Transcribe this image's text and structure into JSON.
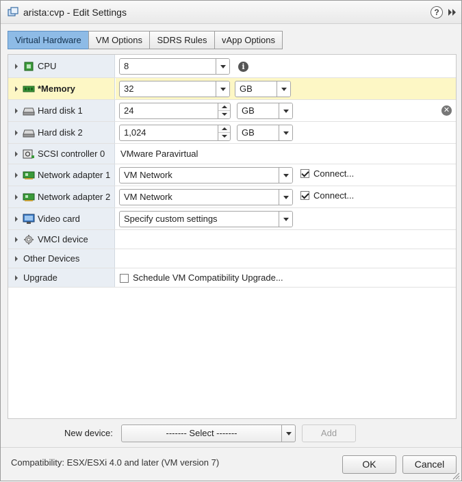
{
  "window": {
    "title": "arista:cvp - Edit Settings",
    "help_symbol": "?"
  },
  "tabs": [
    {
      "label": "Virtual Hardware",
      "active": true
    },
    {
      "label": "VM Options",
      "active": false
    },
    {
      "label": "SDRS Rules",
      "active": false
    },
    {
      "label": "vApp Options",
      "active": false
    }
  ],
  "hardware": {
    "cpu": {
      "label": "CPU",
      "value": "8",
      "icon": "cpu-chip-icon"
    },
    "memory": {
      "label": "*Memory",
      "value": "32",
      "unit": "GB",
      "icon": "memory-module-icon"
    },
    "hard_disk_1": {
      "label": "Hard disk 1",
      "value": "24",
      "unit": "GB",
      "icon": "hard-disk-icon"
    },
    "hard_disk_2": {
      "label": "Hard disk 2",
      "value": "1,024",
      "unit": "GB",
      "icon": "hard-disk-icon"
    },
    "scsi": {
      "label": "SCSI controller 0",
      "value": "VMware Paravirtual",
      "icon": "scsi-controller-icon"
    },
    "net1": {
      "label": "Network adapter 1",
      "value": "VM Network",
      "connect_label": "Connect...",
      "connected": true,
      "icon": "network-card-icon"
    },
    "net2": {
      "label": "Network adapter 2",
      "value": "VM Network",
      "connect_label": "Connect...",
      "connected": true,
      "icon": "network-card-icon"
    },
    "video": {
      "label": "Video card",
      "value": "Specify custom settings",
      "icon": "monitor-icon"
    },
    "vmci": {
      "label": "VMCI device",
      "icon": "gear-icon"
    },
    "other": {
      "label": "Other Devices"
    },
    "upgrade": {
      "label": "Upgrade",
      "checkbox_label": "Schedule VM Compatibility Upgrade...",
      "checked": false
    }
  },
  "footer": {
    "new_device_label": "New device:",
    "new_device_select": "------- Select -------",
    "add_label": "Add",
    "compatibility": "Compatibility: ESX/ESXi 4.0 and later (VM version 7)",
    "ok_label": "OK",
    "cancel_label": "Cancel"
  },
  "colors": {
    "active_tab": "#8ebbe6",
    "label_column": "#e9eef4",
    "highlight_row": "#fdf7c5",
    "device_icon_green": "#3a9a3a"
  }
}
